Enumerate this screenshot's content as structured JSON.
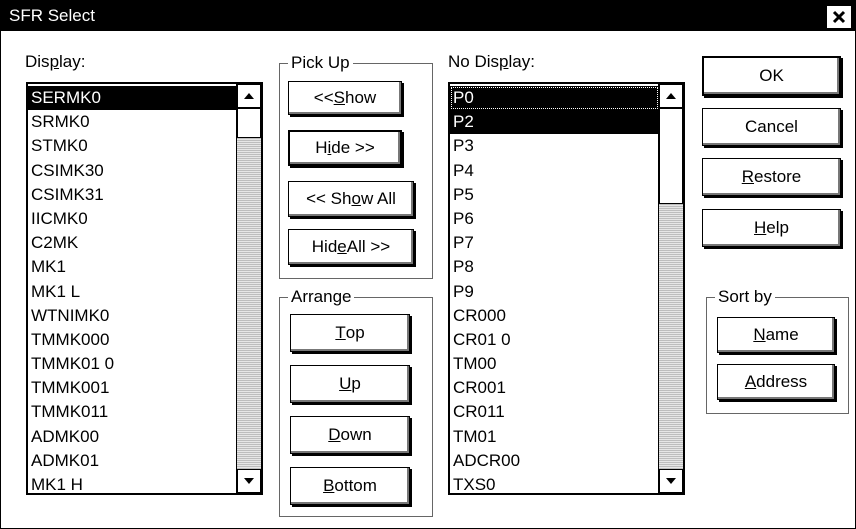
{
  "window": {
    "title": "SFR Select"
  },
  "display": {
    "label": "Display:",
    "items": [
      {
        "text": "SERMK0",
        "selected": true
      },
      {
        "text": "SRMK0"
      },
      {
        "text": "STMK0"
      },
      {
        "text": "CSIMK30"
      },
      {
        "text": "CSIMK31"
      },
      {
        "text": "IICMK0"
      },
      {
        "text": "C2MK"
      },
      {
        "text": "MK1"
      },
      {
        "text": "MK1 L"
      },
      {
        "text": "WTNIMK0"
      },
      {
        "text": "TMMK000"
      },
      {
        "text": "TMMK01 0"
      },
      {
        "text": "TMMK001"
      },
      {
        "text": "TMMK011"
      },
      {
        "text": "ADMK00"
      },
      {
        "text": "ADMK01"
      },
      {
        "text": "MK1 H"
      }
    ]
  },
  "pickup": {
    "legend": "Pick Up",
    "buttons": [
      {
        "pre": "<< ",
        "u": "S",
        "post": "how"
      },
      {
        "pre": "H",
        "u": "i",
        "post": "de >>"
      },
      {
        "pre": "<< Sh",
        "u": "o",
        "post": "w All"
      },
      {
        "pre": "Hid",
        "u": "e",
        "post": " All >>"
      }
    ]
  },
  "arrange": {
    "legend": "Arrange",
    "buttons": [
      {
        "pre": "",
        "u": "T",
        "post": "op"
      },
      {
        "pre": "",
        "u": "U",
        "post": "p"
      },
      {
        "pre": "",
        "u": "D",
        "post": "own"
      },
      {
        "pre": "",
        "u": "B",
        "post": "ottom"
      }
    ]
  },
  "nodisplay": {
    "label": "No Display:",
    "items": [
      {
        "text": "P0",
        "selected": true,
        "focused": true
      },
      {
        "text": "P2",
        "selected": true
      },
      {
        "text": "P3"
      },
      {
        "text": "P4"
      },
      {
        "text": "P5"
      },
      {
        "text": "P6"
      },
      {
        "text": "P7"
      },
      {
        "text": "P8"
      },
      {
        "text": "P9"
      },
      {
        "text": "CR000"
      },
      {
        "text": "CR01 0"
      },
      {
        "text": "TM00"
      },
      {
        "text": "CR001"
      },
      {
        "text": "CR011"
      },
      {
        "text": "TM01"
      },
      {
        "text": "ADCR00"
      },
      {
        "text": "TXS0"
      }
    ]
  },
  "actions": {
    "ok": {
      "pre": "OK",
      "u": "",
      "post": ""
    },
    "cancel": {
      "pre": "Cancel",
      "u": "",
      "post": ""
    },
    "restore": {
      "pre": "",
      "u": "R",
      "post": "estore"
    },
    "help": {
      "pre": "",
      "u": "H",
      "post": "elp"
    }
  },
  "sortby": {
    "legend": "Sort by",
    "name": {
      "pre": "",
      "u": "N",
      "post": "ame"
    },
    "address": {
      "pre": "",
      "u": "A",
      "post": "ddress"
    }
  },
  "icons": {
    "close": "close-icon",
    "scroll_up": "arrow-up-icon",
    "scroll_down": "arrow-down-icon"
  }
}
